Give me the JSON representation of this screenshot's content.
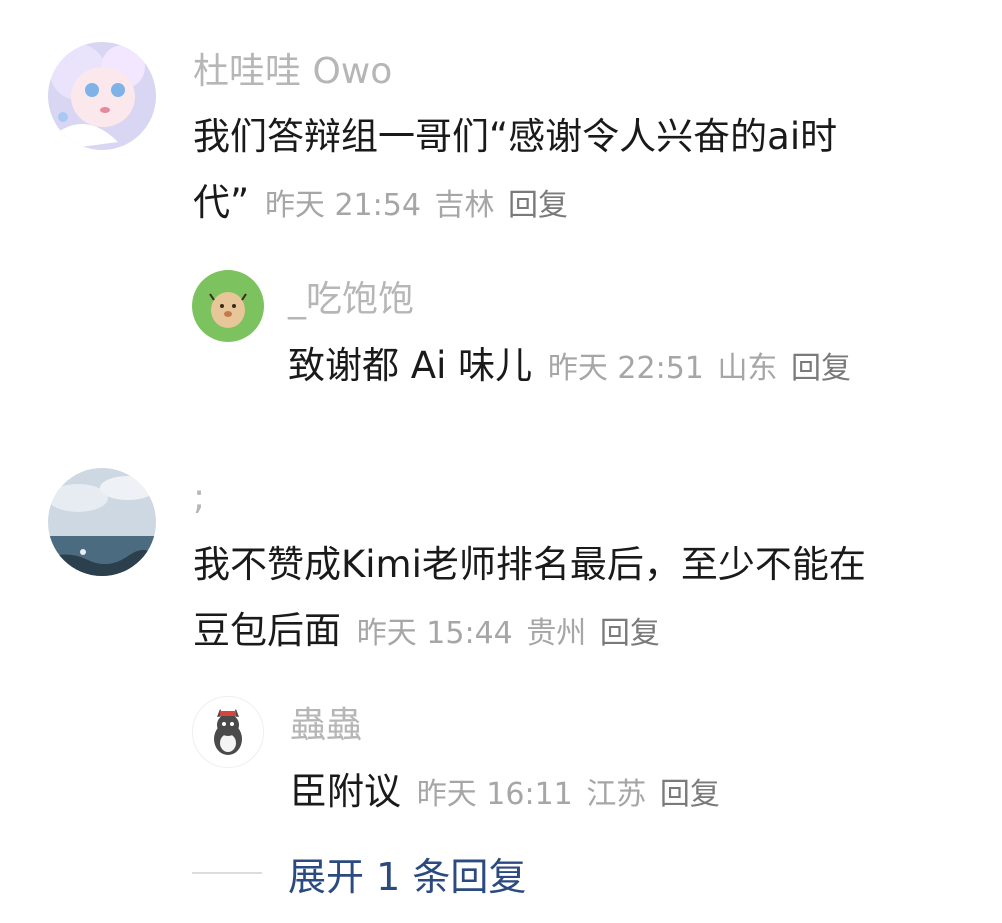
{
  "comments": [
    {
      "username": "杜哇哇 Owo",
      "text_line1": "我们答辩组一哥们“感谢令人兴奋的ai时",
      "text_line2": "代”",
      "time": "昨天 21:54",
      "location": "吉林",
      "reply_label": "回复",
      "reply": {
        "username": "_吃饱饱",
        "text": "致谢都 Ai 味儿",
        "time": "昨天 22:51",
        "location": "山东",
        "reply_label": "回复"
      }
    },
    {
      "username": ";",
      "text_line1": "我不赞成Kimi老师排名最后，至少不能在",
      "text_line2": "豆包后面",
      "time": "昨天 15:44",
      "location": "贵州",
      "reply_label": "回复",
      "reply": {
        "username": "蟲蟲",
        "text": "臣附议",
        "time": "昨天 16:11",
        "location": "江苏",
        "reply_label": "回复"
      }
    }
  ],
  "expand_label": "展开 1 条回复",
  "colors": {
    "username": "#b6b6b6",
    "body_text": "#1a1a1a",
    "meta": "#a6a6a6",
    "expand_link": "#2b4a7f"
  }
}
